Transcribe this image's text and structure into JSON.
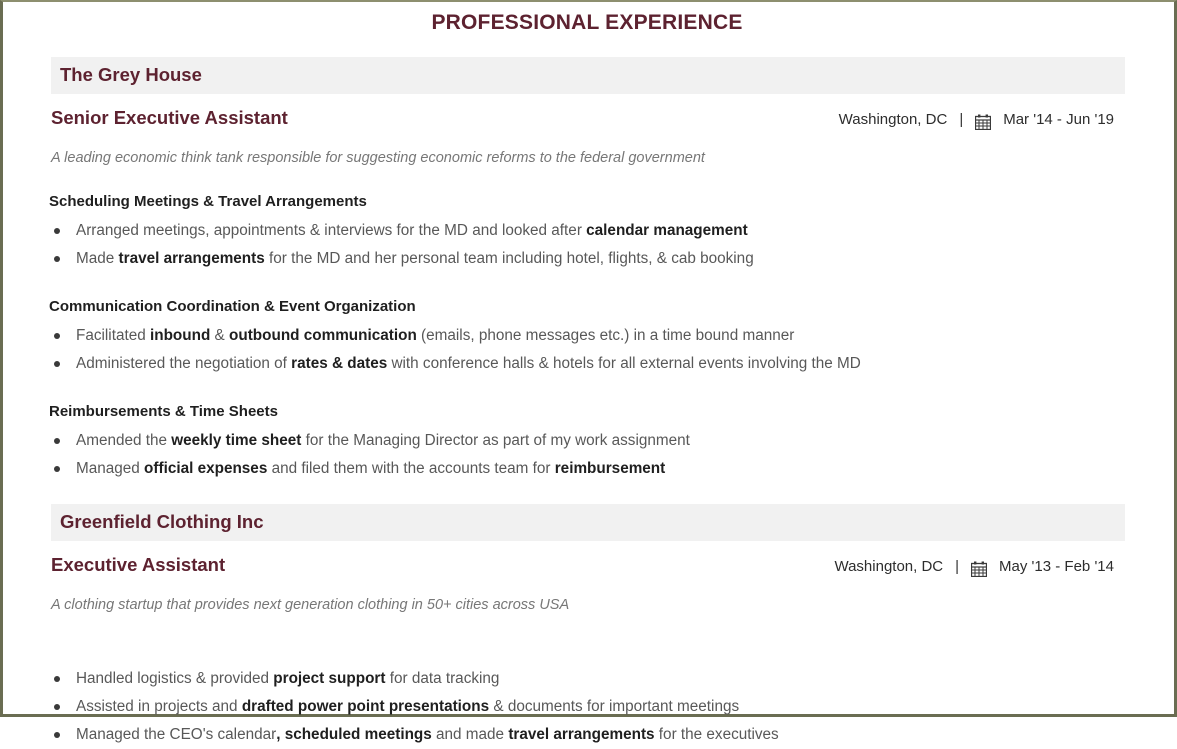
{
  "section": {
    "title": "PROFESSIONAL EXPERIENCE",
    "accent_color": "#5d2230",
    "band_color": "#f1f1f1",
    "border_color": "#6a6d52"
  },
  "jobs": [
    {
      "company": "The Grey House",
      "role": "Senior Executive Assistant",
      "location": "Washington, DC",
      "separator": "|",
      "calendar_icon": "calendar-icon",
      "dates": "Mar '14 - Jun '19",
      "blurb": "A leading economic think tank responsible for suggesting economic reforms to the federal government",
      "groups": [
        {
          "subhead": "Scheduling Meetings & Travel Arrangements",
          "bullets": [
            [
              {
                "t": "Arranged meetings, appointments & interviews for the MD and looked after ",
                "b": false
              },
              {
                "t": "calendar management",
                "b": true
              }
            ],
            [
              {
                "t": "Made ",
                "b": false
              },
              {
                "t": "travel arrangements",
                "b": true
              },
              {
                "t": " for the MD and her personal team including hotel, flights, & cab booking",
                "b": false
              }
            ]
          ]
        },
        {
          "subhead": "Communication Coordination & Event Organization",
          "bullets": [
            [
              {
                "t": "Facilitated ",
                "b": false
              },
              {
                "t": "inbound",
                "b": true
              },
              {
                "t": " & ",
                "b": false
              },
              {
                "t": "outbound communication",
                "b": true
              },
              {
                "t": " (emails, phone messages etc.) in a time bound manner",
                "b": false
              }
            ],
            [
              {
                "t": "Administered the negotiation of ",
                "b": false
              },
              {
                "t": "rates & dates",
                "b": true
              },
              {
                "t": " with conference halls & hotels for all external events involving the MD",
                "b": false
              }
            ]
          ]
        },
        {
          "subhead": "Reimbursements & Time Sheets",
          "bullets": [
            [
              {
                "t": "Amended the ",
                "b": false
              },
              {
                "t": "weekly time sheet",
                "b": true
              },
              {
                "t": " for the Managing Director as part of my work assignment",
                "b": false
              }
            ],
            [
              {
                "t": "Managed ",
                "b": false
              },
              {
                "t": "official expenses",
                "b": true
              },
              {
                "t": " and filed them with the accounts team for ",
                "b": false
              },
              {
                "t": "reimbursement",
                "b": true
              }
            ]
          ]
        }
      ]
    },
    {
      "company": "Greenfield Clothing Inc",
      "role": "Executive Assistant",
      "location": "Washington, DC",
      "separator": "|",
      "calendar_icon": "calendar-icon",
      "dates": "May '13 - Feb '14",
      "blurb": "A clothing startup that provides next generation clothing in 50+ cities across USA",
      "groups": [
        {
          "subhead": "",
          "bullets": [
            [
              {
                "t": "Handled logistics & provided ",
                "b": false
              },
              {
                "t": "project support",
                "b": true
              },
              {
                "t": " for data tracking",
                "b": false
              }
            ],
            [
              {
                "t": "Assisted in projects and ",
                "b": false
              },
              {
                "t": "drafted power point presentations",
                "b": true
              },
              {
                "t": " & documents for important meetings",
                "b": false
              }
            ],
            [
              {
                "t": "Managed the CEO's calendar",
                "b": false
              },
              {
                "t": ", scheduled meetings",
                "b": true
              },
              {
                "t": " and made ",
                "b": false
              },
              {
                "t": "travel arrangements",
                "b": true
              },
              {
                "t": " for the executives",
                "b": false
              }
            ]
          ]
        }
      ]
    }
  ]
}
